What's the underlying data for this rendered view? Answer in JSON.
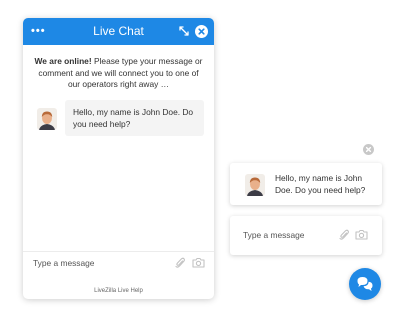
{
  "chat": {
    "title": "Live Chat",
    "intro_bold": "We are online!",
    "intro_text": " Please type your message or comment and we will connect you to one of our operators right away …",
    "message": "Hello, my name is John Doe. Do you need help?",
    "input_placeholder": "Type a message",
    "footer": "LiveZilla Live Help"
  },
  "floating": {
    "message": "Hello, my name is John Doe. Do you need help?",
    "input_placeholder": "Type a message"
  },
  "icons": {
    "menu": "menu-dots-icon",
    "resize": "resize-icon",
    "close": "close-icon",
    "attach": "paperclip-icon",
    "camera": "camera-icon",
    "dismiss": "dismiss-icon",
    "chat_fab": "chat-bubbles-icon"
  },
  "colors": {
    "accent": "#1e88e5",
    "bubble_bg": "#f4f4f4",
    "text": "#333333",
    "icon_gray": "#c2c2c2"
  }
}
